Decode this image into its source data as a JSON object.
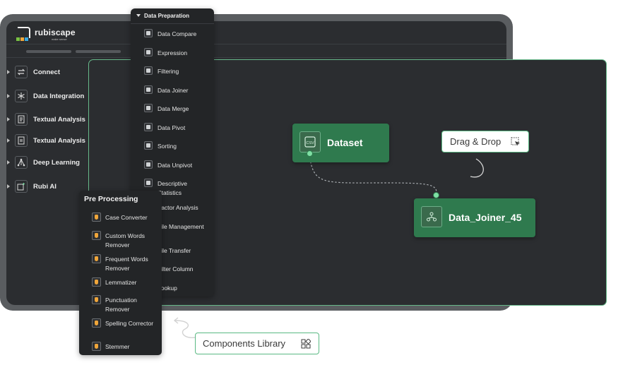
{
  "app": {
    "logo_name": "rubiscape",
    "logo_tagline": "make sense"
  },
  "sidebar": {
    "items": [
      {
        "label": "Connect",
        "icon": "arrows-exchange-icon"
      },
      {
        "label": "Data Integration",
        "icon": "asterisk-icon"
      },
      {
        "label": "Textual Analysis",
        "icon": "document-lines-icon"
      },
      {
        "label": "Textual Analysis",
        "icon": "document-icon"
      },
      {
        "label": "Deep Learning",
        "icon": "network-icon"
      },
      {
        "label": "Rubi AI",
        "icon": "ai-sparkle-icon"
      }
    ]
  },
  "data_preparation": {
    "title": "Data Preparation",
    "items": [
      {
        "label": "Data Compare"
      },
      {
        "label": "Expression"
      },
      {
        "label": "Filtering"
      },
      {
        "label": "Data Joiner"
      },
      {
        "label": "Data Merge"
      },
      {
        "label": "Data Pivot"
      },
      {
        "label": "Sorting"
      },
      {
        "label": "Data Unpivot"
      },
      {
        "label": "Descriptive Statistics"
      },
      {
        "label": "Factor Analysis"
      },
      {
        "label": "File Management"
      },
      {
        "label": "File Transfer"
      },
      {
        "label": "Filter Column"
      },
      {
        "label": "Lookup"
      }
    ]
  },
  "pre_processing": {
    "title": "Pre Processing",
    "items": [
      {
        "label": "Case Converter"
      },
      {
        "label": "Custom Words Remover"
      },
      {
        "label": "Frequent Words Remover"
      },
      {
        "label": "Lemmatizer"
      },
      {
        "label": "Punctuation Remover"
      },
      {
        "label": "Spelling Corrector"
      },
      {
        "label": "Stemmer"
      }
    ]
  },
  "canvas": {
    "dataset_node": {
      "label": "Dataset",
      "icon_text": "CSV"
    },
    "joiner_node": {
      "label": "Data_Joiner_45"
    }
  },
  "callouts": {
    "drag_drop": "Drag & Drop",
    "components_library": "Components Library"
  },
  "colors": {
    "node_green": "#2f7a4e",
    "accent_green": "#5ab983",
    "dark_panel": "#2b2d30",
    "pp_icon_orange": "#f0a63a"
  }
}
